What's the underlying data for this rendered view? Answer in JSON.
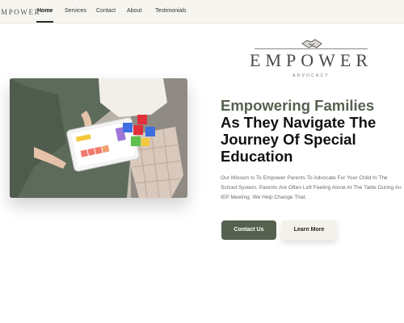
{
  "nav": {
    "logo": "EMPOWER",
    "items": [
      {
        "label": "Home",
        "active": true
      },
      {
        "label": "Services"
      },
      {
        "label": "Contact"
      },
      {
        "label": "About"
      },
      {
        "label": "Testimonials"
      }
    ]
  },
  "brand": {
    "wordmark": "EMPOWER",
    "tagline": "ADVOCACY",
    "icon": "handshake-icon"
  },
  "hero": {
    "headline_accent": "Empowering Families",
    "headline_lines": [
      "As They Navigate The",
      "Journey Of Special",
      "Education"
    ],
    "paragraph": "Our Mission Is To Empower Parents To Advocate For Your Child In The School System. Parents Are Often Left Feeling Alone At The Table During An IEP Meeting. We Help Change That.",
    "buttons": {
      "primary": "Contact Us",
      "secondary": "Learn More"
    }
  },
  "colors": {
    "accent": "#56614f",
    "nav_bg": "#f6f5ef",
    "secondary_button_bg": "#f3f1e9"
  }
}
